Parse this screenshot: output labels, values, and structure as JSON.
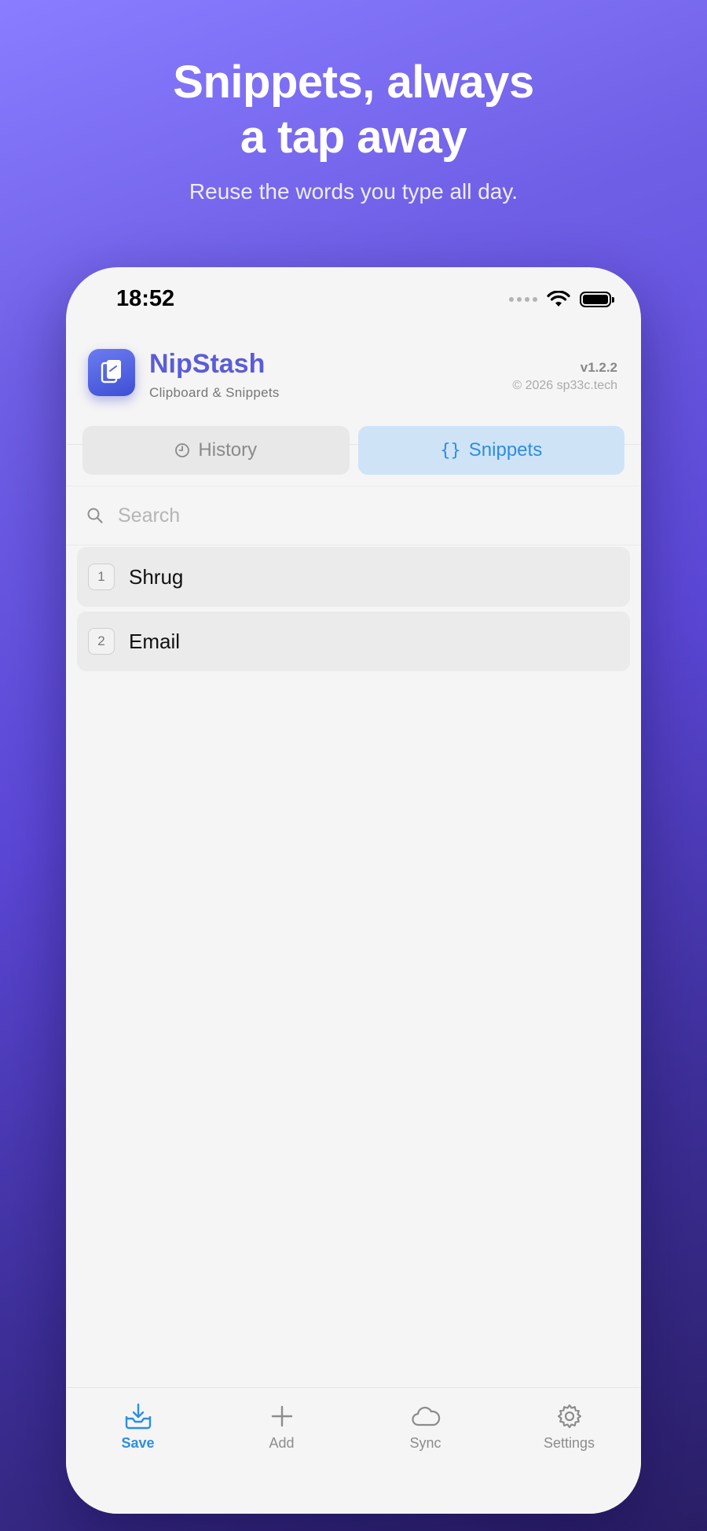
{
  "hero": {
    "title_line1": "Snippets, always",
    "title_line2": "a tap away",
    "subtitle": "Reuse the words you type all day."
  },
  "status_bar": {
    "time": "18:52"
  },
  "app": {
    "name": "NipStash",
    "tagline": "Clipboard & Snippets",
    "version": "v1.2.2",
    "copyright": "© 2026 sp33c.tech"
  },
  "tabs": [
    {
      "label": "History",
      "icon": "clock-icon",
      "active": false
    },
    {
      "label": "Snippets",
      "icon": "braces-icon",
      "active": true
    }
  ],
  "search": {
    "placeholder": "Search",
    "value": ""
  },
  "snippets": [
    {
      "index": "1",
      "label": "Shrug"
    },
    {
      "index": "2",
      "label": "Email"
    }
  ],
  "tabbar": [
    {
      "label": "Save",
      "icon": "inbox-download-icon",
      "active": true
    },
    {
      "label": "Add",
      "icon": "plus-icon",
      "active": false
    },
    {
      "label": "Sync",
      "icon": "cloud-icon",
      "active": false
    },
    {
      "label": "Settings",
      "icon": "gear-icon",
      "active": false
    }
  ],
  "colors": {
    "accent": "#2d8ee0",
    "brand": "#5a5cd8",
    "active_tab_bg": "#cfe3f7"
  }
}
